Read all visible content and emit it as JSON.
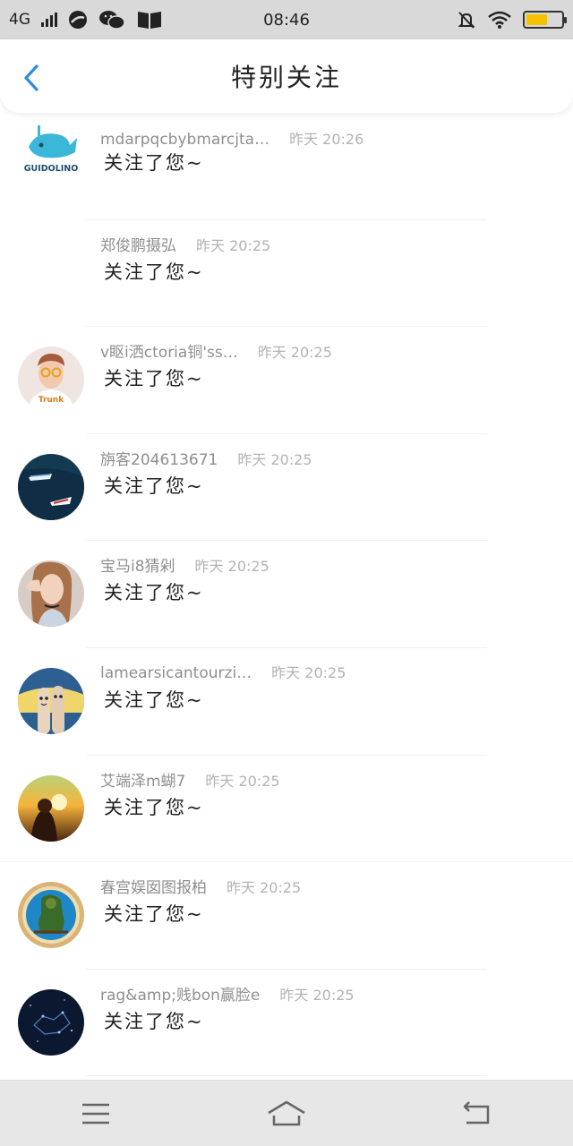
{
  "status_bar": {
    "network": "4G",
    "time": "08:46",
    "battery_level": 0.6,
    "battery_color": "#f6c200"
  },
  "header": {
    "title": "特别关注",
    "back_icon": "chevron-left-icon",
    "accent": "#2f8be0"
  },
  "items": [
    {
      "name": "mdarpqcbybmarcjta…",
      "time": "昨天 20:26",
      "message": "关注了您~",
      "logo_text": "GUIDOLINO"
    },
    {
      "name": "郑俊鹏摄弘",
      "time": "昨天 20:25",
      "message": "关注了您~"
    },
    {
      "name": "v眍i洒ctoria铜'ss…",
      "time": "昨天 20:25",
      "message": "关注了您~",
      "shirt_text": "Trunk"
    },
    {
      "name": "旃客204613671",
      "time": "昨天 20:25",
      "message": "关注了您~"
    },
    {
      "name": "宝马i8猜剁",
      "time": "昨天 20:25",
      "message": "关注了您~"
    },
    {
      "name": "lamearsicantourzi…",
      "time": "昨天 20:25",
      "message": "关注了您~"
    },
    {
      "name": "艾端泽m蝴7",
      "time": "昨天 20:25",
      "message": "关注了您~"
    },
    {
      "name": "春宫娱囡图报柏",
      "time": "昨天 20:25",
      "message": "关注了您~"
    },
    {
      "name": "rag&amp;贱bon赢脸e",
      "time": "昨天 20:25",
      "message": "关注了您~"
    }
  ],
  "bottom_nav": {
    "icons": [
      "menu-icon",
      "home-icon",
      "back-icon"
    ]
  }
}
